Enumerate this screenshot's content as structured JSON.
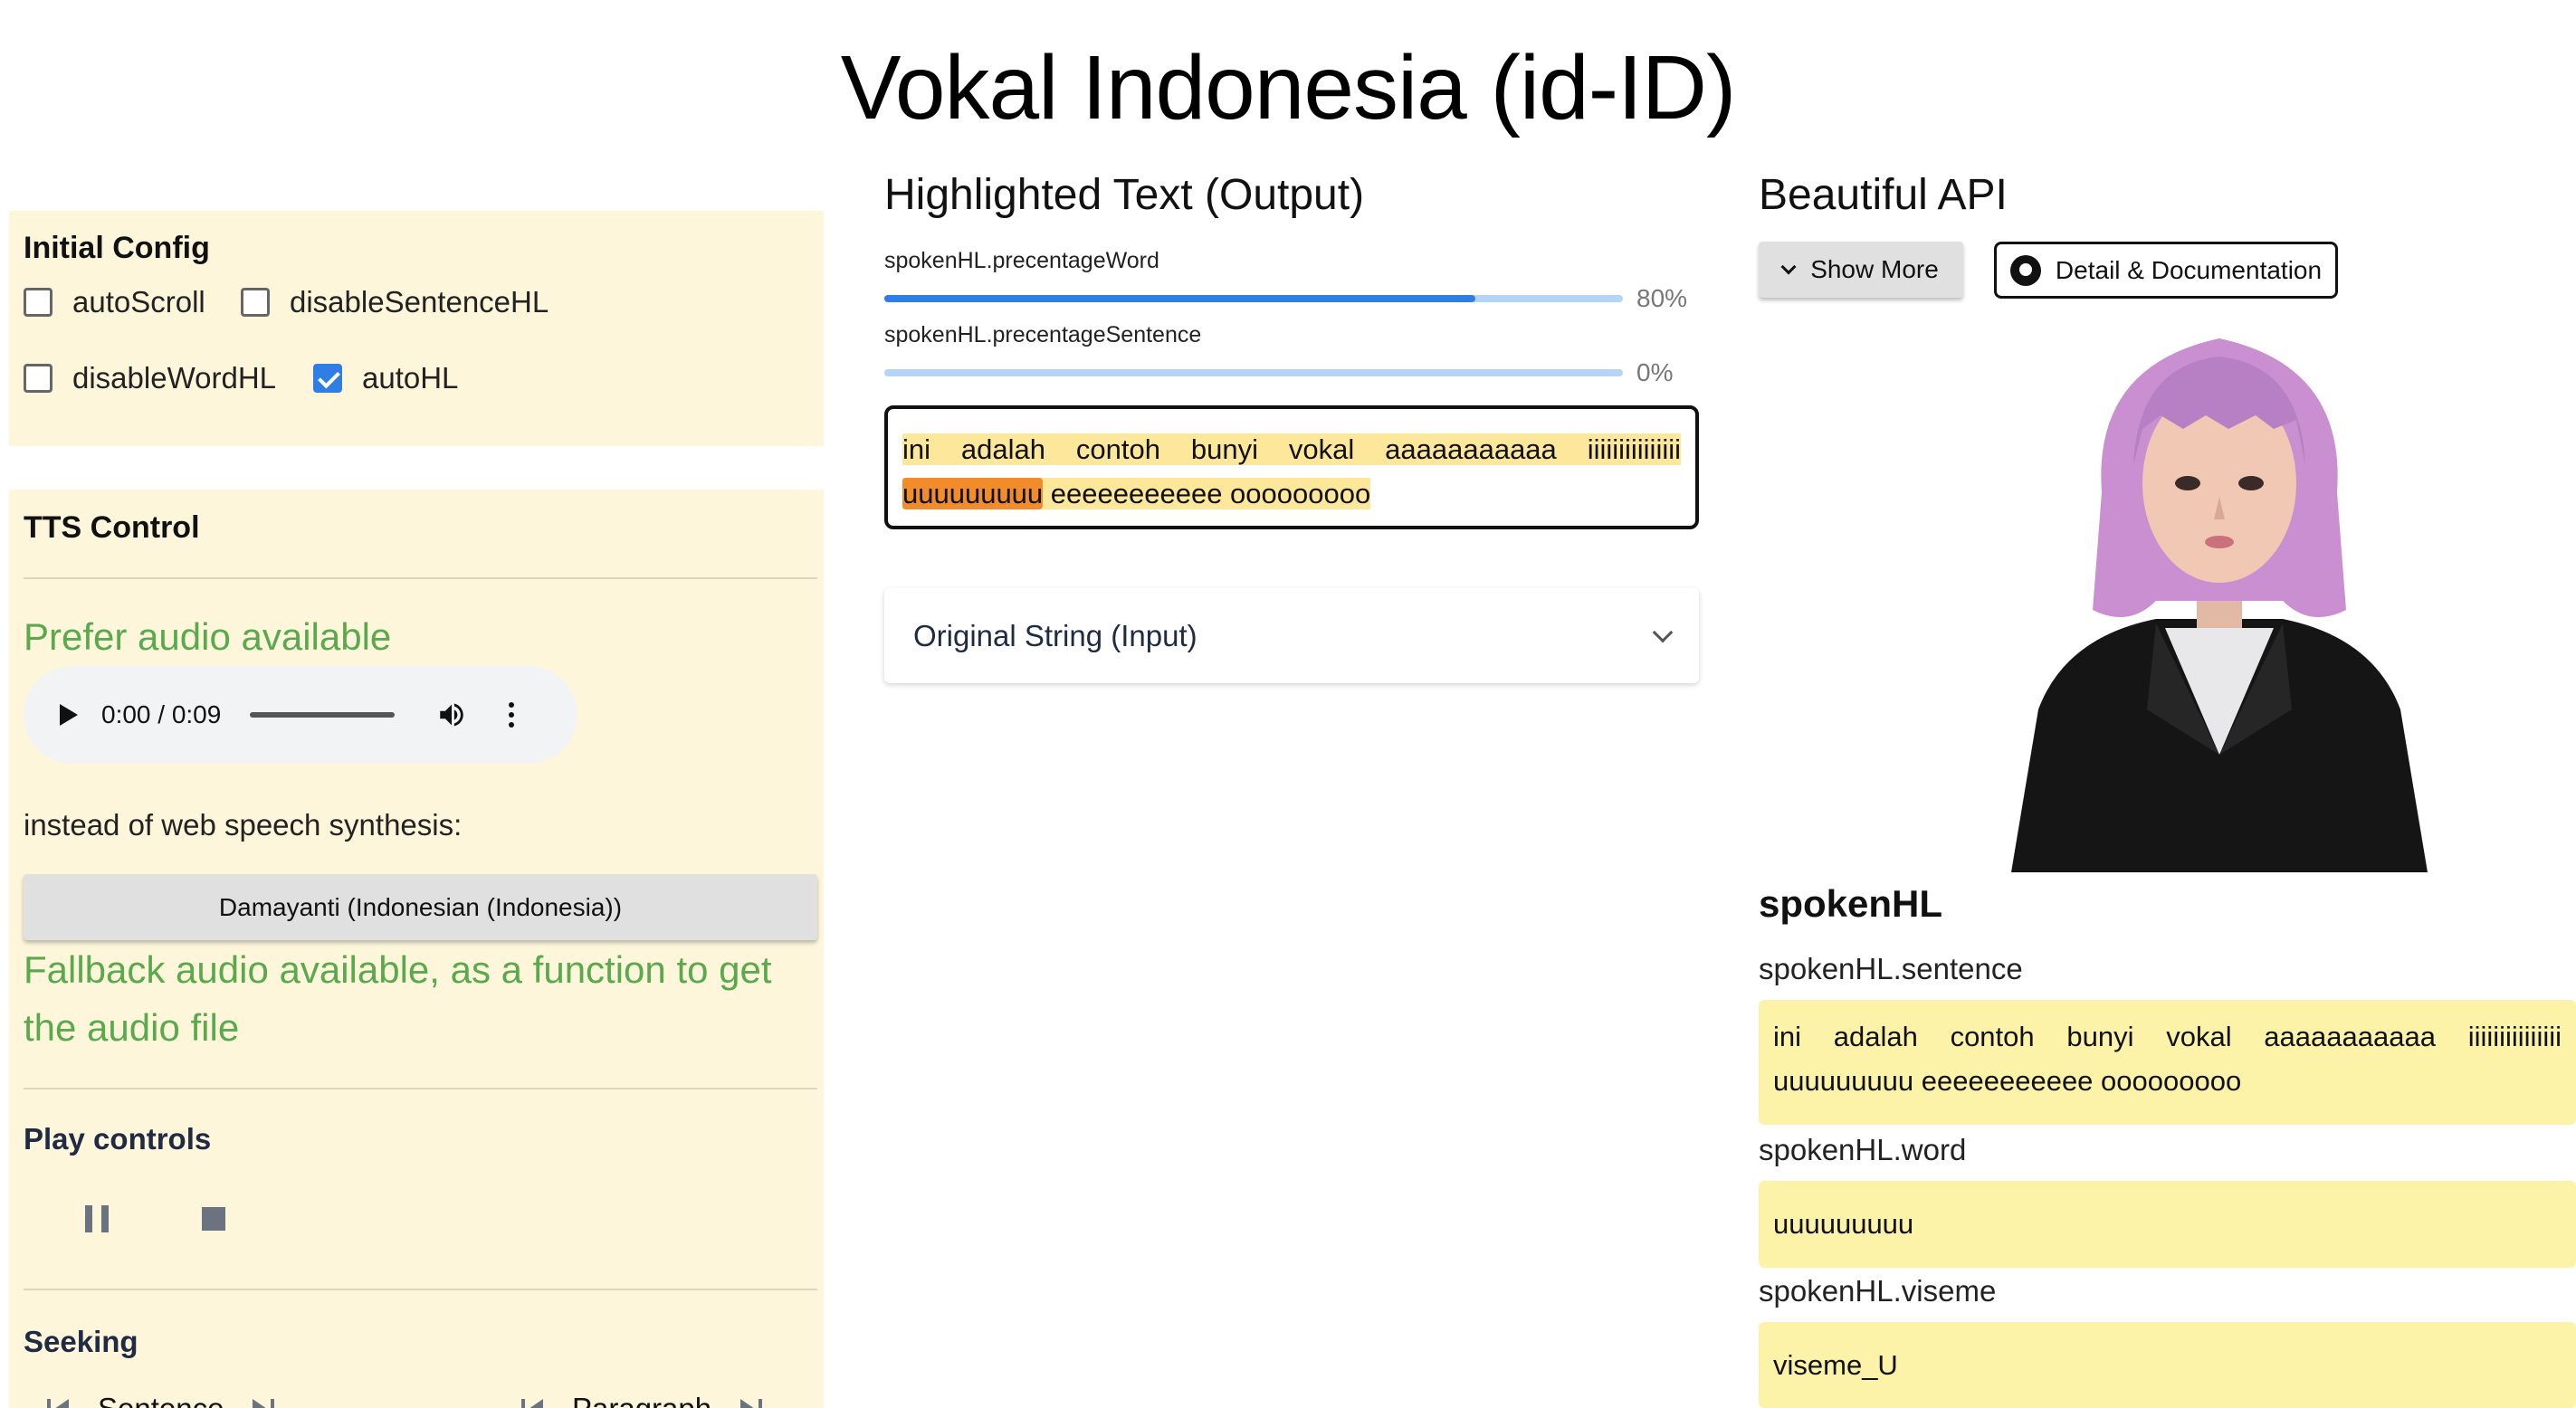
{
  "page_title": "Vokal Indonesia (id-ID)",
  "initial_config": {
    "heading": "Initial Config",
    "options": [
      {
        "label": "autoScroll",
        "checked": false
      },
      {
        "label": "disableSentenceHL",
        "checked": false
      },
      {
        "label": "disableWordHL",
        "checked": false
      },
      {
        "label": "autoHL",
        "checked": true
      }
    ]
  },
  "tts_control": {
    "heading": "TTS Control",
    "prefer_audio": "Prefer audio available",
    "audio_player": {
      "time": "0:00 / 0:09"
    },
    "instead_text": "instead of web speech synthesis:",
    "voice_button": "Damayanti (Indonesian (Indonesia))",
    "fallback_text": "Fallback audio available, as a function to get the audio file",
    "play_controls_heading": "Play controls",
    "seeking_heading": "Seeking",
    "seek_sentence": "Sentence",
    "seek_paragraph": "Paragraph"
  },
  "output": {
    "heading": "Highlighted Text (Output)",
    "word_label": "spokenHL.precentageWord",
    "word_percent": "80%",
    "word_progress": 0.8,
    "sentence_label": "spokenHL.precentageSentence",
    "sentence_percent": "0%",
    "sentence_progress": 0.0,
    "text_before_word": "ini adalah contoh bunyi vokal aaaaaaaaaaa iiiiiiiiiiiiiii",
    "current_word": "uuuuuuuuu",
    "text_after_word": "eeeeeeeeeee ooooooooo"
  },
  "input_accordion": {
    "title": "Original String (Input)"
  },
  "api": {
    "heading": "Beautiful API",
    "show_more": "Show More",
    "doc_button": "Detail & Documentation",
    "spoken_title": "spokenHL",
    "sentence_label": "spokenHL.sentence",
    "sentence_value": "ini adalah contoh bunyi vokal aaaaaaaaaaa iiiiiiiiiiiiiii uuuuuuuuu eeeeeeeeeee ooooooooo",
    "word_label": "spokenHL.word",
    "word_value": "uuuuuuuuu",
    "viseme_label": "spokenHL.viseme",
    "viseme_value": "viseme_U"
  },
  "colors": {
    "panel_bg": "#fdf6da",
    "green_text": "#5aa94d",
    "sentence_highlight": "#fde79a",
    "word_highlight": "#f08c2c",
    "api_box_bg": "#fdf3a8",
    "progress_blue": "#2f7ee6"
  }
}
